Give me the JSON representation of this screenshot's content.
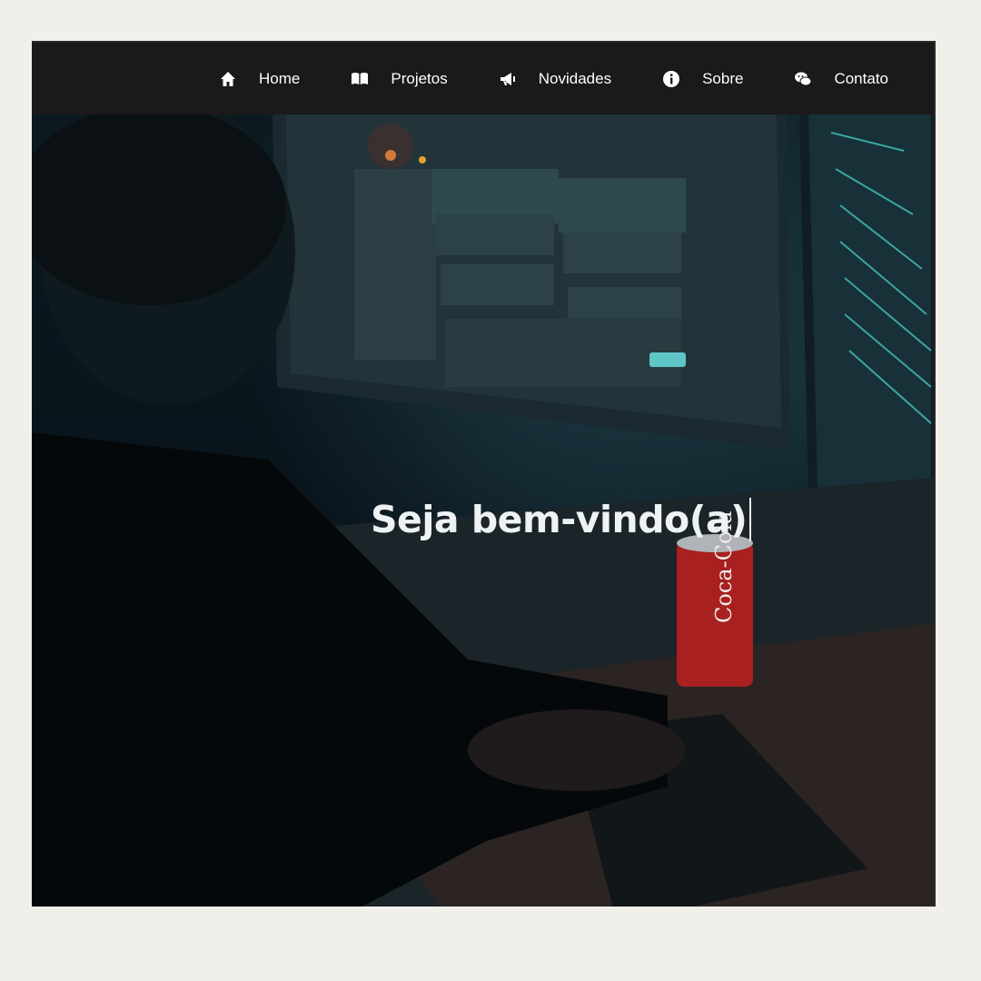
{
  "nav": {
    "items": [
      {
        "label": "Home",
        "icon": "home-icon"
      },
      {
        "label": "Projetos",
        "icon": "book-icon"
      },
      {
        "label": "Novidades",
        "icon": "megaphone-icon"
      },
      {
        "label": "Sobre",
        "icon": "info-icon"
      },
      {
        "label": "Contato",
        "icon": "chat-icon"
      }
    ]
  },
  "hero": {
    "title": "Seja bem-vindo(a)"
  },
  "colors": {
    "navbar_bg": "#1b191a",
    "page_bg": "#f0efea",
    "text": "#ffffff"
  }
}
